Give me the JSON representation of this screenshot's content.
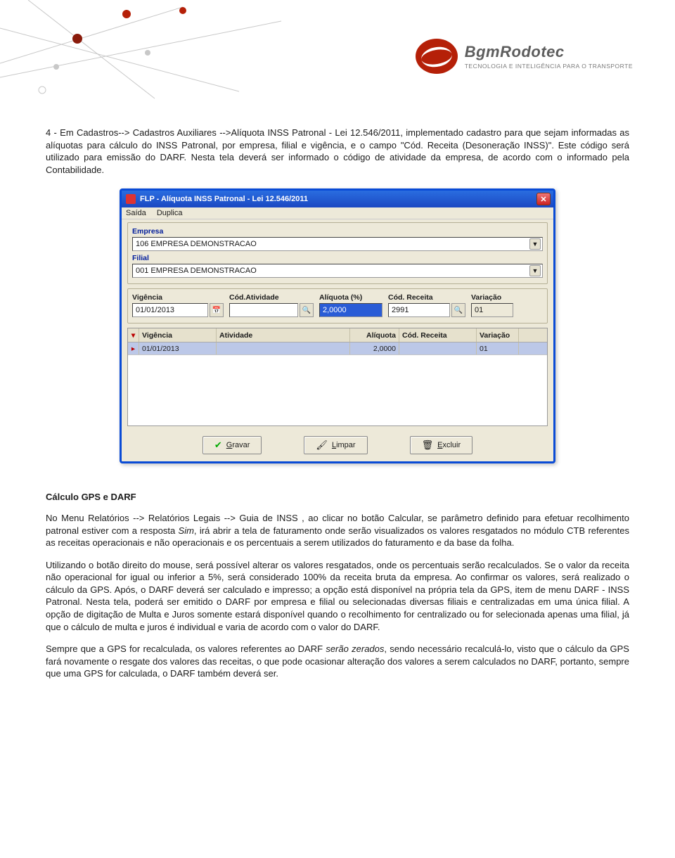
{
  "logo": {
    "brand": "BgmRodotec",
    "tagline": "TECNOLOGIA E INTELIGÊNCIA PARA O TRANSPORTE"
  },
  "intro_paragraph": "4 - Em Cadastros--> Cadastros Auxiliares -->Alíquota INSS Patronal - Lei 12.546/2011, implementado cadastro para que sejam informadas as alíquotas para cálculo do INSS Patronal, por empresa, filial e vigência, e o campo \"Cód. Receita (Desoneração INSS)\". Este código será utilizado para emissão do DARF. Nesta tela deverá ser informado o código de atividade da empresa, de acordo com o informado pela Contabilidade.",
  "dialog": {
    "title": "FLP - Alíquota INSS Patronal - Lei 12.546/2011",
    "menu": {
      "saida": "Saída",
      "duplica": "Duplica"
    },
    "labels": {
      "empresa": "Empresa",
      "filial": "Filial",
      "vigencia": "Vigência",
      "cod_atividade": "Cód.Atividade",
      "aliquota": "Alíquota (%)",
      "cod_receita": "Cód. Receita",
      "variacao": "Variação"
    },
    "values": {
      "empresa": "106 EMPRESA DEMONSTRACAO",
      "filial": "001 EMPRESA DEMONSTRACAO",
      "vigencia": "01/01/2013",
      "cod_atividade": "",
      "aliquota": "2,0000",
      "cod_receita": "2991",
      "variacao": "01"
    },
    "grid_headers": {
      "vigencia": "Vigência",
      "atividade": "Atividade",
      "aliquota": "Alíquota",
      "cod_receita": "Cód. Receita",
      "variacao": "Variação"
    },
    "grid_rows": [
      {
        "vigencia": "01/01/2013",
        "atividade": "",
        "aliquota": "2,0000",
        "cod_receita": "",
        "variacao": "01"
      }
    ],
    "buttons": {
      "gravar": "Gravar",
      "limpar": "Limpar",
      "excluir": "Excluir"
    }
  },
  "section_title": "Cálculo GPS e DARF",
  "body_p1_a": "No Menu Relatórios --> Relatórios Legais --> Guia de INSS , ao clicar no botão Calcular, se parâmetro definido para efetuar recolhimento patronal estiver com a resposta ",
  "body_p1_sim": "Sim",
  "body_p1_b": ", irá abrir a tela de faturamento onde serão visualizados os valores resgatados no módulo CTB referentes as receitas operacionais e não operacionais e os percentuais a serem utilizados do faturamento e da base da folha.",
  "body_p2": "Utilizando o botão direito do mouse, será possível alterar os valores resgatados, onde os percentuais serão recalculados. Se o valor da receita não operacional for igual ou inferior a 5%, será considerado 100% da receita bruta da empresa. Ao confirmar os valores, será realizado o cálculo da GPS. Após, o DARF deverá ser calculado e impresso; a opção está disponível na própria tela da GPS, item de menu DARF - INSS Patronal.  Nesta tela, poderá ser emitido o DARF por empresa e filial ou selecionadas diversas filiais e centralizadas em uma única filial.  A opção de digitação de Multa e Juros somente estará disponível quando o recolhimento for centralizado ou for selecionada apenas uma filial, já que o cálculo de multa e juros é individual e varia de acordo com o valor do DARF.",
  "body_p3_a": "Sempre que a GPS for recalculada, os valores referentes ao DARF ",
  "body_p3_em": "serão zerados",
  "body_p3_b": ", sendo necessário recalculá-lo, visto que o cálculo da GPS fará novamente o resgate dos valores das receitas, o que pode ocasionar alteração  dos valores a serem calculados no DARF, portanto, sempre que uma GPS for calculada, o DARF também deverá ser."
}
